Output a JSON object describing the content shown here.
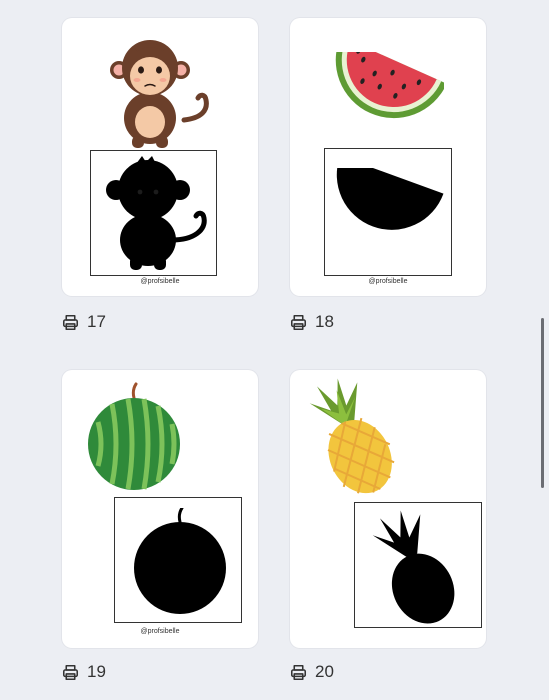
{
  "cards": [
    {
      "number": "17",
      "credit": "@profsibelle",
      "subject": "monkey"
    },
    {
      "number": "18",
      "credit": "@profsibelle",
      "subject": "watermelon-slice"
    },
    {
      "number": "19",
      "credit": "@profsibelle",
      "subject": "watermelon"
    },
    {
      "number": "20",
      "credit": "",
      "subject": "pineapple"
    }
  ],
  "icons": {
    "label_icon": "printer-icon"
  },
  "colors": {
    "background": "#eceef3",
    "card": "#ffffff",
    "text": "#333333"
  }
}
